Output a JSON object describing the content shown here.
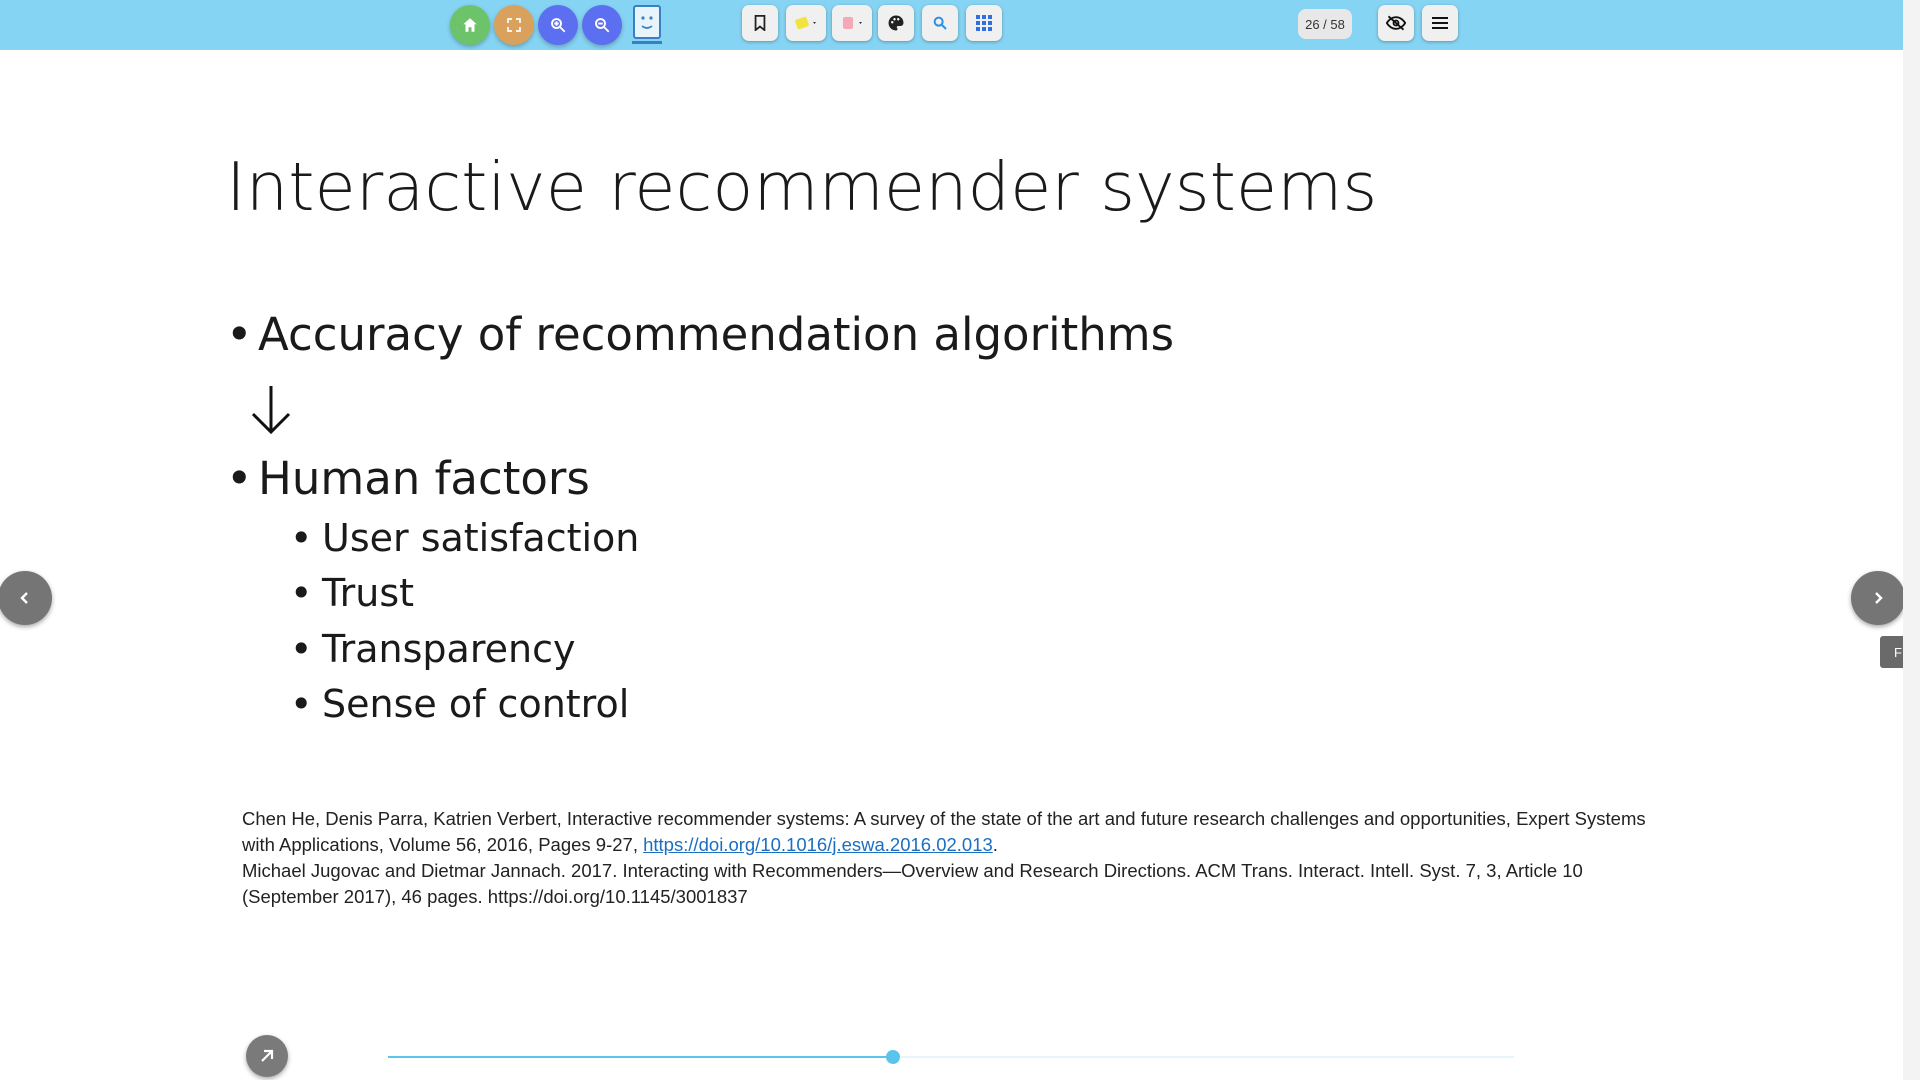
{
  "toolbar": {
    "page_indicator": "26 / 58",
    "colors": {
      "bar": "#86d4f3",
      "home": "#6cc36a",
      "fullscreen": "#d9a15c",
      "zoom": "#5b6ff0",
      "search": "#2f8fe0",
      "highlighter": "#f2e340",
      "eraser": "#f5a9b8"
    },
    "icons": [
      "home-icon",
      "fullscreen-icon",
      "zoom-in-icon",
      "zoom-out-icon",
      "app-logo",
      "bookmark-icon",
      "highlighter-icon",
      "eraser-icon",
      "palette-icon",
      "search-icon",
      "grid-icon",
      "hide-icon",
      "menu-icon"
    ]
  },
  "slide": {
    "title": "Interactive recommender systems",
    "bullet_1": "Accuracy of recommendation algorithms",
    "arrow": "↓",
    "bullet_2": "Human factors",
    "sub_bullets": [
      "User satisfaction",
      "Trust",
      "Transparency",
      "Sense of control"
    ],
    "bullet_glyph": "•",
    "references": {
      "ref1_text": "Chen He, Denis Parra, Katrien Verbert, Interactive recommender systems: A survey of the state of the art and future research challenges and opportunities, Expert Systems with Applications, Volume 56, 2016, Pages 9-27, ",
      "ref1_link": "https://doi.org/10.1016/j.eswa.2016.02.013",
      "ref1_end": ".",
      "ref2": "Michael Jugovac and Dietmar Jannach. 2017. Interacting with Recommenders—Overview and Research Directions. ACM Trans. Interact. Intell. Syst. 7, 3, Article 10 (September 2017), 46 pages. https://doi.org/10.1145/3001837"
    }
  },
  "side_tab": "F",
  "progress": {
    "current_page": 26,
    "total_pages": 58,
    "fraction": 0.4483
  }
}
